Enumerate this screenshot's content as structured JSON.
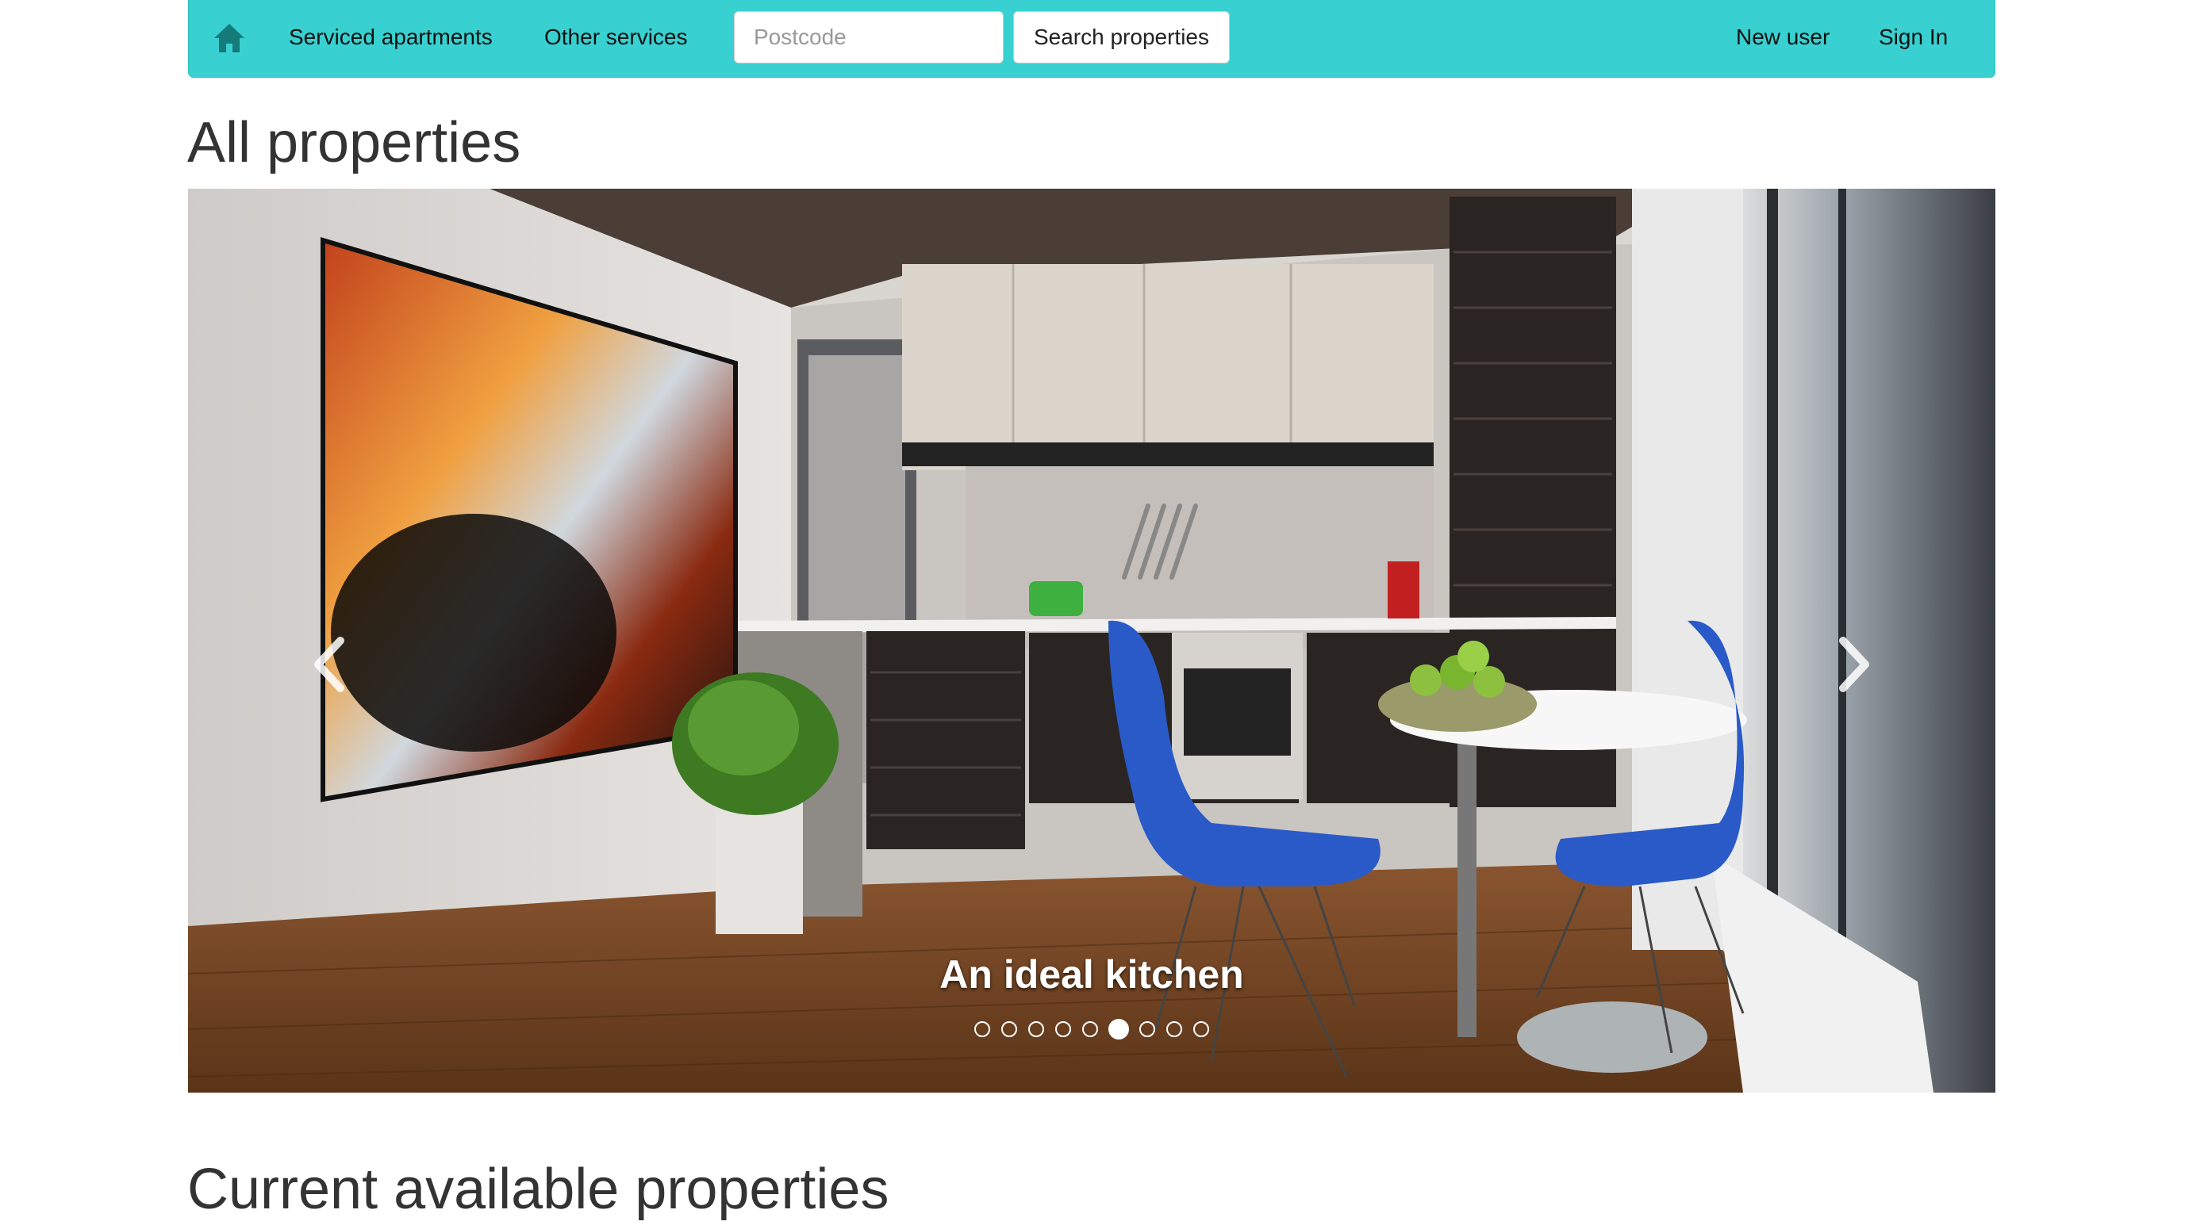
{
  "navbar": {
    "home_icon": "home-icon",
    "links": [
      "Serviced apartments",
      "Other services"
    ],
    "postcode_placeholder": "Postcode",
    "search_label": "Search properties",
    "new_user_label": "New user",
    "sign_in_label": "Sign In"
  },
  "page_title": "All properties",
  "carousel": {
    "caption": "An ideal kitchen",
    "slide_count": 9,
    "active_index": 5,
    "prev_icon": "chevron-left-icon",
    "next_icon": "chevron-right-icon"
  },
  "section_title": "Current available properties",
  "colors": {
    "navbar": "#38d0d0",
    "home_icon": "#147a7a"
  }
}
